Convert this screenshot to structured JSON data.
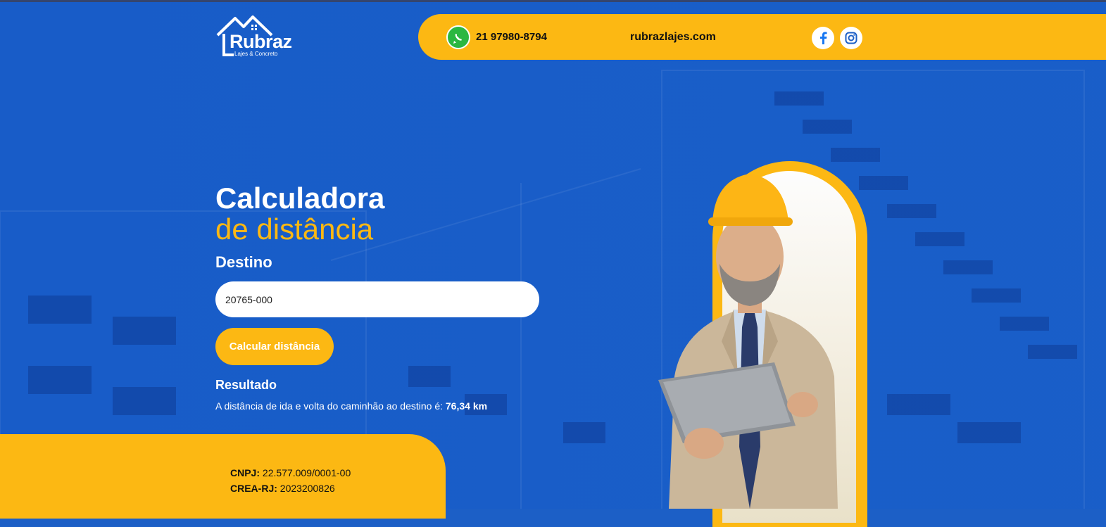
{
  "header": {
    "logo": {
      "name": "Rubraz",
      "tagline": "Lajes & Concreto"
    },
    "phone": "21 97980-8794",
    "website": "rubrazlajes.com",
    "social": [
      {
        "icon": "facebook-icon"
      },
      {
        "icon": "instagram-icon"
      }
    ]
  },
  "main": {
    "title_line1": "Calculadora",
    "title_line2": "de distância",
    "destination_label": "Destino",
    "destination_value": "20765-000",
    "calculate_button": "Calcular distância",
    "result_title": "Resultado",
    "result_text": "A distância de ida e volta do caminhão ao destino é: ",
    "result_value": "76,34 km"
  },
  "footer": {
    "cnpj_label": "CNPJ:",
    "cnpj_value": "22.577.009/0001-00",
    "crea_label": "CREA-RJ:",
    "crea_value": "2023200826"
  },
  "colors": {
    "primary_blue": "#1c5fc6",
    "accent_yellow": "#fcb813",
    "whatsapp_green": "#2bb741",
    "facebook_blue": "#1877f2"
  }
}
